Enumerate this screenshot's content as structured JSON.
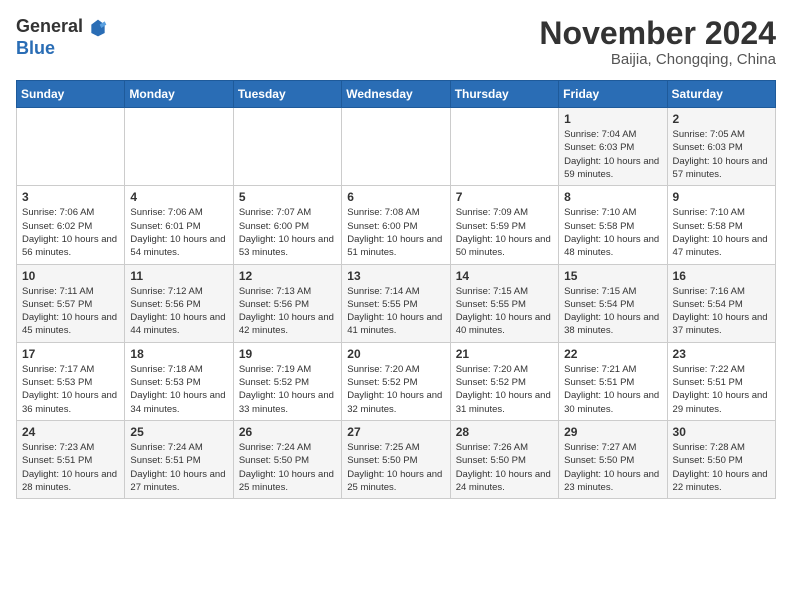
{
  "header": {
    "logo_general": "General",
    "logo_blue": "Blue",
    "month_title": "November 2024",
    "location": "Baijia, Chongqing, China"
  },
  "weekdays": [
    "Sunday",
    "Monday",
    "Tuesday",
    "Wednesday",
    "Thursday",
    "Friday",
    "Saturday"
  ],
  "weeks": [
    [
      {
        "day": "",
        "info": ""
      },
      {
        "day": "",
        "info": ""
      },
      {
        "day": "",
        "info": ""
      },
      {
        "day": "",
        "info": ""
      },
      {
        "day": "",
        "info": ""
      },
      {
        "day": "1",
        "info": "Sunrise: 7:04 AM\nSunset: 6:03 PM\nDaylight: 10 hours and 59 minutes."
      },
      {
        "day": "2",
        "info": "Sunrise: 7:05 AM\nSunset: 6:03 PM\nDaylight: 10 hours and 57 minutes."
      }
    ],
    [
      {
        "day": "3",
        "info": "Sunrise: 7:06 AM\nSunset: 6:02 PM\nDaylight: 10 hours and 56 minutes."
      },
      {
        "day": "4",
        "info": "Sunrise: 7:06 AM\nSunset: 6:01 PM\nDaylight: 10 hours and 54 minutes."
      },
      {
        "day": "5",
        "info": "Sunrise: 7:07 AM\nSunset: 6:00 PM\nDaylight: 10 hours and 53 minutes."
      },
      {
        "day": "6",
        "info": "Sunrise: 7:08 AM\nSunset: 6:00 PM\nDaylight: 10 hours and 51 minutes."
      },
      {
        "day": "7",
        "info": "Sunrise: 7:09 AM\nSunset: 5:59 PM\nDaylight: 10 hours and 50 minutes."
      },
      {
        "day": "8",
        "info": "Sunrise: 7:10 AM\nSunset: 5:58 PM\nDaylight: 10 hours and 48 minutes."
      },
      {
        "day": "9",
        "info": "Sunrise: 7:10 AM\nSunset: 5:58 PM\nDaylight: 10 hours and 47 minutes."
      }
    ],
    [
      {
        "day": "10",
        "info": "Sunrise: 7:11 AM\nSunset: 5:57 PM\nDaylight: 10 hours and 45 minutes."
      },
      {
        "day": "11",
        "info": "Sunrise: 7:12 AM\nSunset: 5:56 PM\nDaylight: 10 hours and 44 minutes."
      },
      {
        "day": "12",
        "info": "Sunrise: 7:13 AM\nSunset: 5:56 PM\nDaylight: 10 hours and 42 minutes."
      },
      {
        "day": "13",
        "info": "Sunrise: 7:14 AM\nSunset: 5:55 PM\nDaylight: 10 hours and 41 minutes."
      },
      {
        "day": "14",
        "info": "Sunrise: 7:15 AM\nSunset: 5:55 PM\nDaylight: 10 hours and 40 minutes."
      },
      {
        "day": "15",
        "info": "Sunrise: 7:15 AM\nSunset: 5:54 PM\nDaylight: 10 hours and 38 minutes."
      },
      {
        "day": "16",
        "info": "Sunrise: 7:16 AM\nSunset: 5:54 PM\nDaylight: 10 hours and 37 minutes."
      }
    ],
    [
      {
        "day": "17",
        "info": "Sunrise: 7:17 AM\nSunset: 5:53 PM\nDaylight: 10 hours and 36 minutes."
      },
      {
        "day": "18",
        "info": "Sunrise: 7:18 AM\nSunset: 5:53 PM\nDaylight: 10 hours and 34 minutes."
      },
      {
        "day": "19",
        "info": "Sunrise: 7:19 AM\nSunset: 5:52 PM\nDaylight: 10 hours and 33 minutes."
      },
      {
        "day": "20",
        "info": "Sunrise: 7:20 AM\nSunset: 5:52 PM\nDaylight: 10 hours and 32 minutes."
      },
      {
        "day": "21",
        "info": "Sunrise: 7:20 AM\nSunset: 5:52 PM\nDaylight: 10 hours and 31 minutes."
      },
      {
        "day": "22",
        "info": "Sunrise: 7:21 AM\nSunset: 5:51 PM\nDaylight: 10 hours and 30 minutes."
      },
      {
        "day": "23",
        "info": "Sunrise: 7:22 AM\nSunset: 5:51 PM\nDaylight: 10 hours and 29 minutes."
      }
    ],
    [
      {
        "day": "24",
        "info": "Sunrise: 7:23 AM\nSunset: 5:51 PM\nDaylight: 10 hours and 28 minutes."
      },
      {
        "day": "25",
        "info": "Sunrise: 7:24 AM\nSunset: 5:51 PM\nDaylight: 10 hours and 27 minutes."
      },
      {
        "day": "26",
        "info": "Sunrise: 7:24 AM\nSunset: 5:50 PM\nDaylight: 10 hours and 25 minutes."
      },
      {
        "day": "27",
        "info": "Sunrise: 7:25 AM\nSunset: 5:50 PM\nDaylight: 10 hours and 25 minutes."
      },
      {
        "day": "28",
        "info": "Sunrise: 7:26 AM\nSunset: 5:50 PM\nDaylight: 10 hours and 24 minutes."
      },
      {
        "day": "29",
        "info": "Sunrise: 7:27 AM\nSunset: 5:50 PM\nDaylight: 10 hours and 23 minutes."
      },
      {
        "day": "30",
        "info": "Sunrise: 7:28 AM\nSunset: 5:50 PM\nDaylight: 10 hours and 22 minutes."
      }
    ]
  ]
}
